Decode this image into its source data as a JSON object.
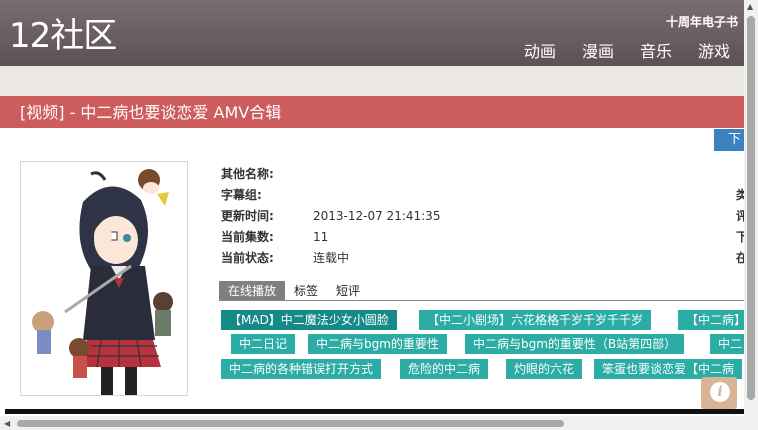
{
  "header": {
    "logo": "12社区",
    "ebook_link": "十周年电子书",
    "nav": [
      "动画",
      "漫画",
      "音乐",
      "游戏"
    ]
  },
  "title_bar": "[视频] - 中二病也要谈恋爱 AMV合辑",
  "download_button": "下",
  "info": {
    "rows": [
      {
        "label": "其他名称:",
        "value": ""
      },
      {
        "label": "字幕组:",
        "value": ""
      },
      {
        "label": "更新时间:",
        "value": "2013-12-07 21:41:35"
      },
      {
        "label": "当前集数:",
        "value": "11"
      },
      {
        "label": "当前状态:",
        "value": "连载中"
      }
    ],
    "side_labels": [
      "类",
      "评",
      "下",
      "在"
    ]
  },
  "tabs": [
    {
      "label": "在线播放",
      "active": true
    },
    {
      "label": "标签",
      "active": false
    },
    {
      "label": "短评",
      "active": false
    }
  ],
  "episodes": [
    [
      "【MAD】中二魔法少女小圆脸",
      "【中二小剧场】六花格格千岁千岁千千岁",
      "【中二病】"
    ],
    [
      "中二日记",
      "中二病与bgm的重要性",
      "中二病与bgm的重要性（B站第四部）",
      "中二"
    ],
    [
      "中二病的各种错误打开方式",
      "危险的中二病",
      "灼眼的六花",
      "笨蛋也要谈恋爱【中二病"
    ]
  ],
  "colors": {
    "header": "#6b5e61",
    "title_bar": "#cd5c5c",
    "chip": "#2bada5",
    "chip_active": "#168a86",
    "download": "#3b82c0"
  }
}
